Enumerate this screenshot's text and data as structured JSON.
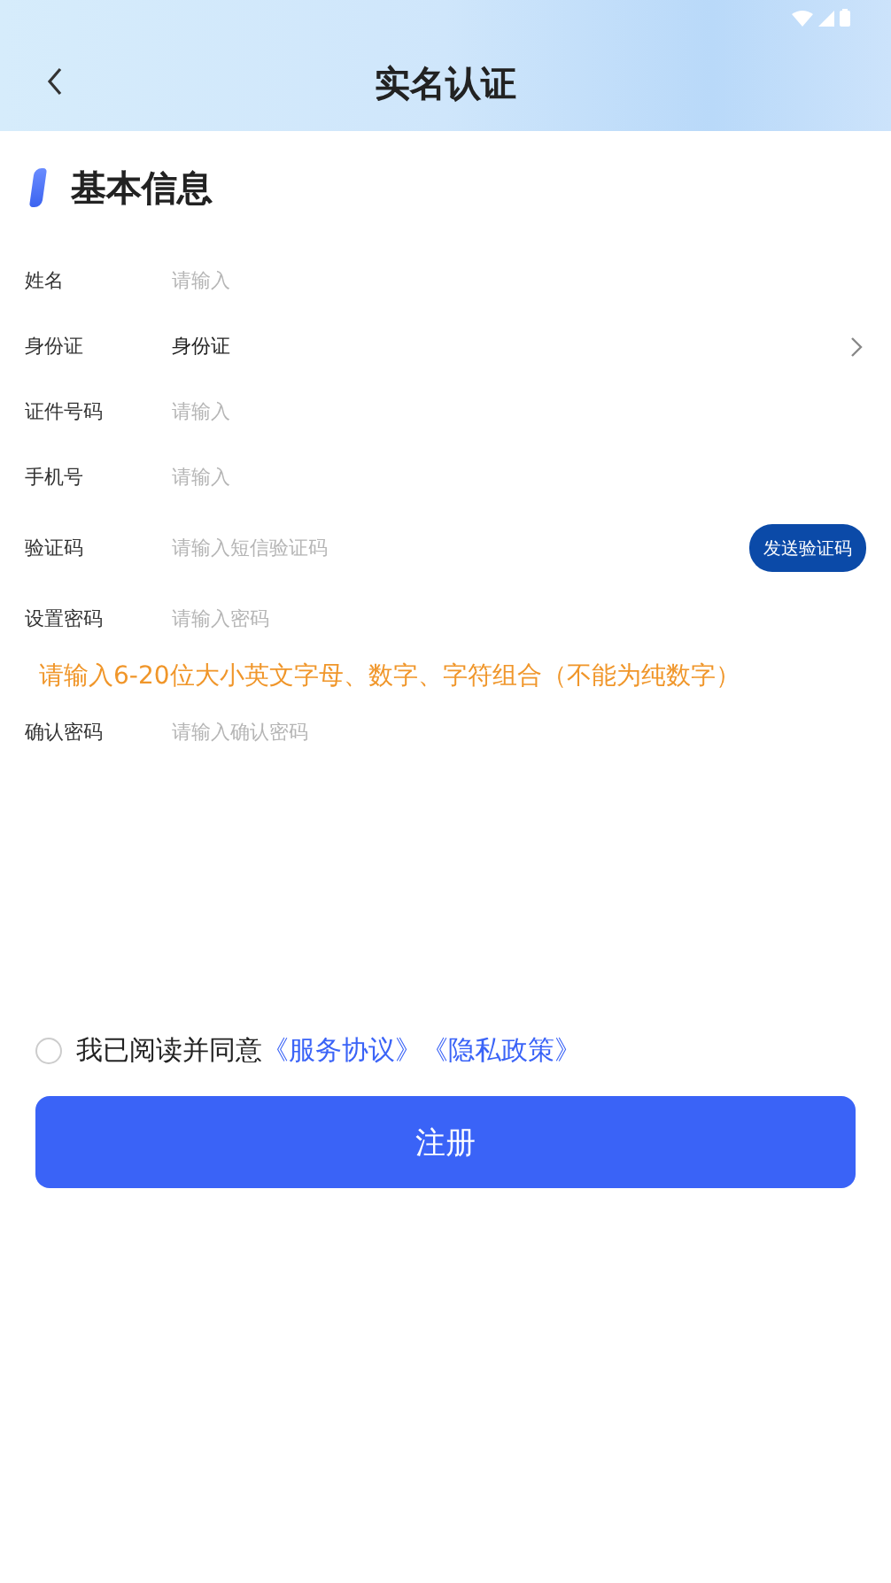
{
  "header": {
    "title": "实名认证"
  },
  "section": {
    "title": "基本信息"
  },
  "fields": [
    {
      "kind": "input",
      "label": "姓名",
      "placeholder": "请输入"
    },
    {
      "kind": "select",
      "label": "身份证",
      "value": "身份证"
    },
    {
      "kind": "input",
      "label": "证件号码",
      "placeholder": "请输入"
    },
    {
      "kind": "input",
      "label": "手机号",
      "placeholder": "请输入"
    },
    {
      "kind": "code",
      "label": "验证码",
      "placeholder": "请输入短信验证码",
      "button": "发送验证码"
    },
    {
      "kind": "input",
      "label": "设置密码",
      "placeholder": "请输入密码",
      "hint": "请输入6-20位大小英文字母、数字、字符组合（不能为纯数字）"
    },
    {
      "kind": "input",
      "label": "确认密码",
      "placeholder": "请输入确认密码"
    }
  ],
  "agreement": {
    "checked": false,
    "text": "我已阅读并同意",
    "links": [
      "《服务协议》",
      "《隐私政策》"
    ]
  },
  "submit": {
    "label": "注册"
  }
}
